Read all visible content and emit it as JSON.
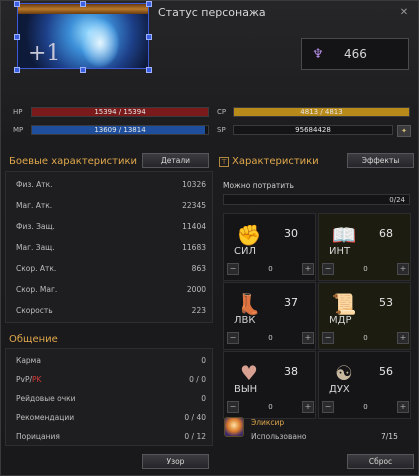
{
  "window": {
    "title": "Статус персонажа",
    "close_glyph": "✕"
  },
  "portrait": {
    "level_label": "+1",
    "icon": "character-portrait"
  },
  "combat_power": {
    "icon": "combat-power-icon",
    "value": "466"
  },
  "bars": {
    "hp": {
      "label": "HP",
      "text": "15394 / 15394",
      "ratio": 1.0,
      "color": "#7a1a1a"
    },
    "mp": {
      "label": "MP",
      "text": "13609 / 13814",
      "ratio": 0.985,
      "color": "#1f4f9c"
    },
    "cp": {
      "label": "CP",
      "text": "4813 / 4813",
      "ratio": 1.0,
      "color": "#b88a1a"
    },
    "sp": {
      "label": "SP",
      "text": "95684428"
    }
  },
  "combat_stats": {
    "title": "Боевые характеристики",
    "details_button": "Детали",
    "rows": [
      {
        "label": "Физ. Атк.",
        "value": "10326"
      },
      {
        "label": "Маг. Атк.",
        "value": "22345"
      },
      {
        "label": "Физ. Защ.",
        "value": "11404"
      },
      {
        "label": "Маг. Защ.",
        "value": "11683"
      },
      {
        "label": "Скор. Атк.",
        "value": "863"
      },
      {
        "label": "Скор. Маг.",
        "value": "2000"
      },
      {
        "label": "Скорость",
        "value": "223"
      }
    ]
  },
  "social": {
    "title": "Общение",
    "rows": [
      {
        "label": "Карма",
        "value": "0"
      },
      {
        "label_a": "PvP/",
        "label_b": "PK",
        "value": "0 / 0"
      },
      {
        "label": "Рейдовые очки",
        "value": "0"
      },
      {
        "label": "Рекомендации",
        "value": "0 / 40"
      },
      {
        "label": "Порицания",
        "value": "0 / 12"
      }
    ],
    "button": "Узор"
  },
  "characteristics": {
    "title": "Характеристики",
    "effects_button": "Эффекты",
    "spendable_label": "Можно потратить",
    "spendable_value": "0/24",
    "stats": [
      {
        "abbr": "СИЛ",
        "value": "30",
        "alloc": "0",
        "icon": "fist-icon"
      },
      {
        "abbr": "ИНТ",
        "value": "68",
        "alloc": "0",
        "icon": "book-icon"
      },
      {
        "abbr": "ЛВК",
        "value": "37",
        "alloc": "0",
        "icon": "boot-icon"
      },
      {
        "abbr": "МДР",
        "value": "53",
        "alloc": "0",
        "icon": "scroll-icon"
      },
      {
        "abbr": "ВЫН",
        "value": "38",
        "alloc": "0",
        "icon": "heart-icon"
      },
      {
        "abbr": "ДУХ",
        "value": "56",
        "alloc": "0",
        "icon": "spirit-icon"
      }
    ],
    "minus": "−",
    "plus": "+"
  },
  "elixir": {
    "title": "Эликсир",
    "used_label": "Использовано",
    "used_value": "7/15",
    "icon": "elixir-icon"
  },
  "reset_button": "Сброс"
}
